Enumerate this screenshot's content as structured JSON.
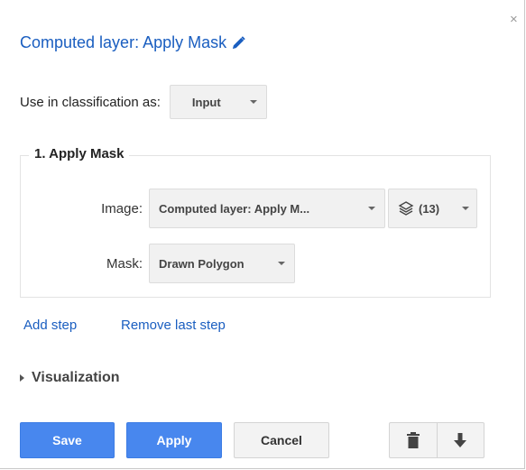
{
  "dialog": {
    "title": "Computed layer: Apply Mask",
    "close_glyph": "×",
    "icons": {
      "close": "close-icon",
      "edit": "pencil-icon"
    }
  },
  "classification": {
    "label": "Use in classification as:",
    "selected": "Input"
  },
  "step": {
    "legend": "1. Apply Mask",
    "image_label": "Image:",
    "image_value": "Computed layer: Apply M...",
    "layers_count": "(13)",
    "layers_icon": "layers-icon",
    "mask_label": "Mask:",
    "mask_value": "Drawn Polygon"
  },
  "links": {
    "add_step": "Add step",
    "remove_last_step": "Remove last step"
  },
  "visualization": {
    "label": "Visualization",
    "expanded": false
  },
  "buttons": {
    "save": "Save",
    "apply": "Apply",
    "cancel": "Cancel",
    "delete_icon": "trash-icon",
    "download_icon": "arrow-down-icon"
  },
  "colors": {
    "accent_link": "#1a5ec0",
    "primary_button": "#4887ee"
  }
}
